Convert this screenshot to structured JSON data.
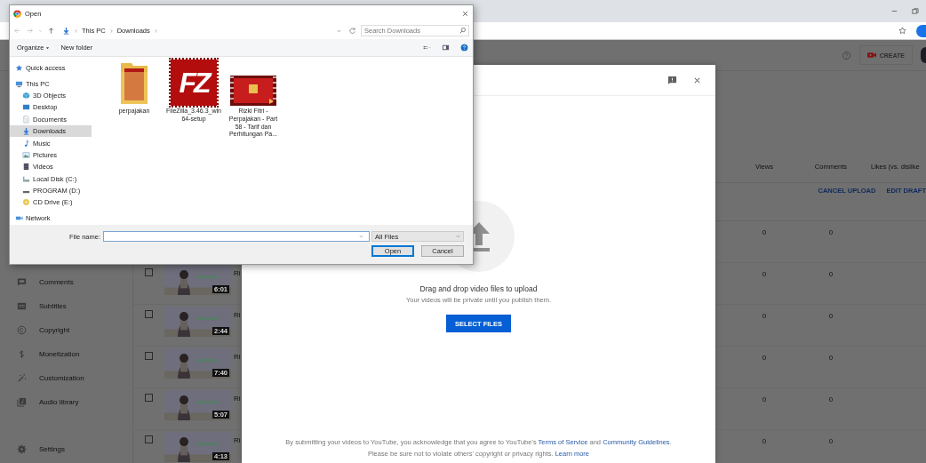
{
  "studio": {
    "create_label": "CREATE",
    "sidebar": {
      "items": [
        {
          "label": "Comments"
        },
        {
          "label": "Subtitles"
        },
        {
          "label": "Copyright"
        },
        {
          "label": "Monetization"
        },
        {
          "label": "Customization"
        },
        {
          "label": "Audio library"
        }
      ],
      "settings": "Settings"
    },
    "table": {
      "columns": [
        "Views",
        "Comments",
        "Likes (vs. dislike"
      ],
      "draft_actions": [
        "CANCEL UPLOAD",
        "EDIT DRAFT"
      ],
      "rows": [
        {
          "views": "0",
          "comments": "0"
        },
        {
          "checked": false,
          "title": "Ri",
          "duration": "6:01",
          "views": "0",
          "comments": "0"
        },
        {
          "checked": false,
          "title": "Ri",
          "duration": "2:44",
          "views": "0",
          "comments": "0"
        },
        {
          "checked": false,
          "title": "Ri",
          "duration": "7:40",
          "views": "0",
          "comments": "0"
        },
        {
          "checked": false,
          "title": "Ri",
          "duration": "5:07",
          "views": "0",
          "comments": "0"
        },
        {
          "checked": false,
          "title": "Ri",
          "duration": "4:13",
          "views": "0",
          "comments": "0"
        }
      ]
    }
  },
  "upload_modal": {
    "prompt": "Drag and drop video files to upload",
    "note": "Your videos will be private until you publish them.",
    "button": "SELECT FILES",
    "legal": [
      [
        {
          "text": "By submitting your videos to YouTube, you acknowledge that you agree to YouTube's "
        },
        {
          "link": "Terms of Service"
        },
        {
          "text": " and "
        },
        {
          "link": "Community Guidelines"
        },
        {
          "text": "."
        }
      ],
      [
        {
          "text": "Please be sure not to violate others' copyright or privacy rights. "
        },
        {
          "link": "Learn more"
        }
      ]
    ]
  },
  "file_dialog": {
    "title": "Open",
    "path": [
      "This PC",
      "Downloads"
    ],
    "search_placeholder": "Search Downloads",
    "organize": "Organize",
    "new_folder": "New folder",
    "nav": [
      {
        "label": "Quick access",
        "selected": false
      },
      {
        "label": "This PC",
        "selected": false,
        "children": [
          {
            "label": "3D Objects",
            "selected": false
          },
          {
            "label": "Desktop",
            "selected": false
          },
          {
            "label": "Documents",
            "selected": false
          },
          {
            "label": "Downloads",
            "selected": true
          },
          {
            "label": "Music",
            "selected": false
          },
          {
            "label": "Pictures",
            "selected": false
          },
          {
            "label": "Videos",
            "selected": false
          },
          {
            "label": "Local Disk (C:)",
            "selected": false
          },
          {
            "label": "PROGRAM (D:)",
            "selected": false
          },
          {
            "label": "CD Drive (E:)",
            "selected": false
          }
        ]
      },
      {
        "label": "Network",
        "selected": false
      }
    ],
    "files": [
      {
        "kind": "folder",
        "name": "perpajakan"
      },
      {
        "kind": "app",
        "name": "FileZilla_3.46.3_win64-setup",
        "logo_text": "FZ"
      },
      {
        "kind": "video",
        "name": "Rizki Fitri - Perpajakan - Part 58 - Tarif dan Perhitungan Pa..."
      }
    ],
    "file_name_label": "File name:",
    "file_type": "All Files",
    "buttons": [
      {
        "label": "Open",
        "default": true
      },
      {
        "label": "Cancel",
        "default": false
      }
    ]
  }
}
